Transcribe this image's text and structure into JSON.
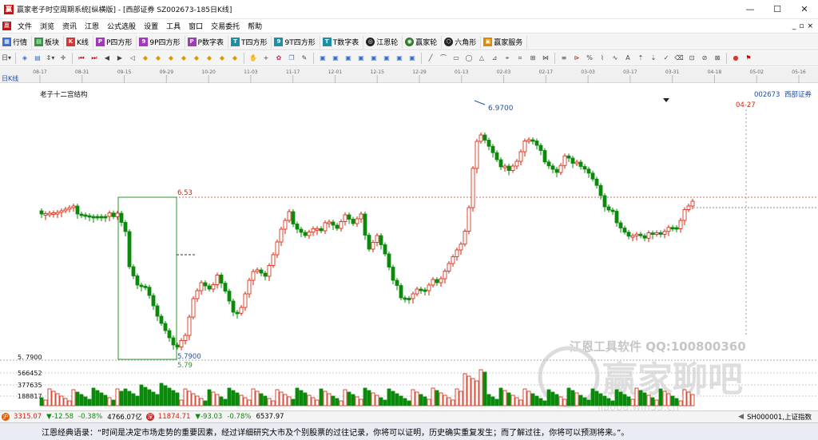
{
  "window": {
    "title": "赢家老子时空周期系统[纵横版] - [西部证券  SZ002673-185日K线]",
    "logo": "赢",
    "buttons": [
      "—",
      "☐",
      "✕"
    ]
  },
  "menu": {
    "logo": "赢",
    "items": [
      "文件",
      "浏览",
      "资讯",
      "江恩",
      "公式选股",
      "设置",
      "工具",
      "窗口",
      "交易委托",
      "帮助"
    ],
    "right": [
      "_",
      "▫",
      "×"
    ]
  },
  "toolbar1": {
    "items": [
      {
        "icon": "table-icon",
        "label": "行情"
      },
      {
        "icon": "grid-icon",
        "label": "板块"
      },
      {
        "icon": "kline-icon",
        "label": "K线"
      },
      {
        "icon": "p-square-icon",
        "label": "P四方形"
      },
      {
        "icon": "p9-square-icon",
        "label": "9P四方形"
      },
      {
        "icon": "p-number-icon",
        "label": "P数字表"
      },
      {
        "icon": "t-square-icon",
        "label": "T四方形"
      },
      {
        "icon": "t9-square-icon",
        "label": "9T四方形"
      },
      {
        "icon": "t-number-icon",
        "label": "T数字表"
      },
      {
        "icon": "gann-wheel-icon",
        "label": "江恩轮"
      },
      {
        "icon": "winner-wheel-icon",
        "label": "赢家轮"
      },
      {
        "icon": "hexagon-icon",
        "label": "六角形"
      },
      {
        "icon": "service-icon",
        "label": "赢家服务"
      }
    ]
  },
  "date_axis": {
    "labels": [
      "08-17",
      "08-31",
      "09-15",
      "09-29",
      "10-20",
      "11-03",
      "11-17",
      "12-01",
      "12-15",
      "12-29",
      "01-13",
      "02-03",
      "02-17",
      "03-03",
      "03-17",
      "03-31",
      "04-18",
      "05-02",
      "05-16"
    ]
  },
  "chart": {
    "period_label": "日K线",
    "overlay_name": "老子十二宫结构",
    "stock_code": "002673",
    "stock_name": "西部证券",
    "future_date": "04-27",
    "high_marker": "6.9700",
    "level_653": "6.53",
    "level_low_a": "5.7900",
    "level_low_b": "5.79",
    "axis_label_low": "5. 7900",
    "volume_ticks": [
      "566452",
      "377635",
      "188817"
    ],
    "watermark_text": "江恩工具软件  QQ:100800360",
    "watermark_logo": "赢家聊吧",
    "watermark_url": "liaoba.win33.cn"
  },
  "status": {
    "badge1": "沪",
    "sh_index": "3315.07",
    "sh_change": "▼-12.58",
    "sh_pct": "-0.38%",
    "sh_amount": "4766.07亿",
    "badge2": "深",
    "sz_index": "11874.71",
    "sz_change": "▼-93.03",
    "sz_pct": "-0.78%",
    "sz_amount": "6537.97",
    "right_code": "SH000001,上证指数"
  },
  "quote": {
    "text": "江恩经典语录：“时间是决定市场走势的重要因素，经过详细研究大市及个别股票的过往记录，你将可以证明，历史确实重复发生；而了解过往，你将可以预测将来。”。"
  },
  "colors": {
    "up": "#d81e06",
    "down": "#0a8a0a",
    "accent_red": "#cc1111",
    "dotted_line": "#e06060"
  }
}
